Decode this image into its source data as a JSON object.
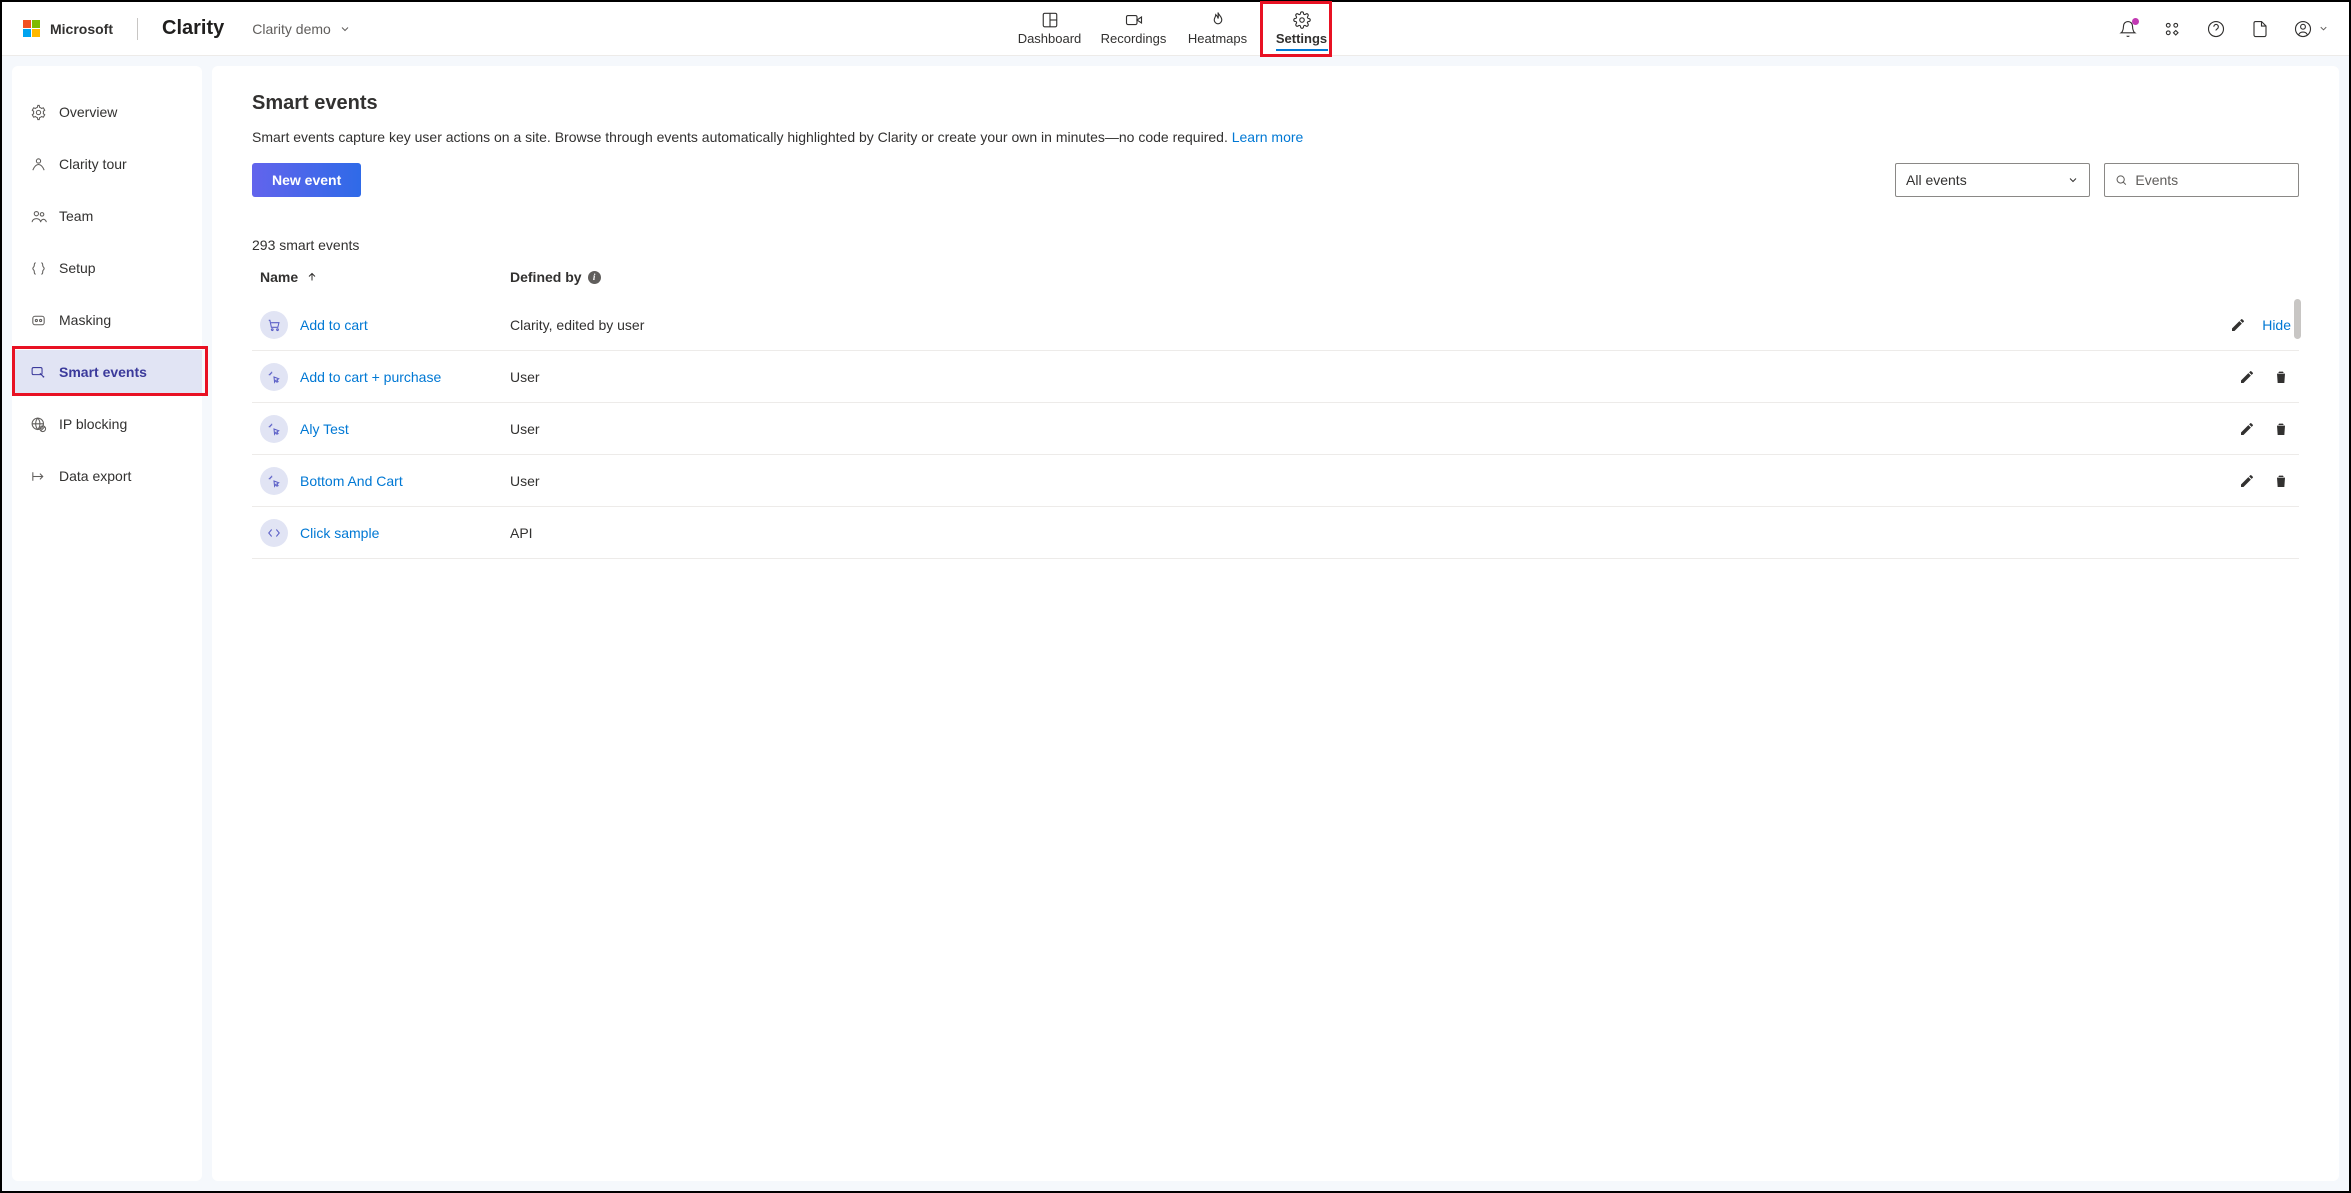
{
  "brand": {
    "company": "Microsoft",
    "product": "Clarity",
    "project": "Clarity demo"
  },
  "topnav": {
    "dashboard": "Dashboard",
    "recordings": "Recordings",
    "heatmaps": "Heatmaps",
    "settings": "Settings"
  },
  "sidebar": {
    "overview": "Overview",
    "tour": "Clarity tour",
    "team": "Team",
    "setup": "Setup",
    "masking": "Masking",
    "smart": "Smart events",
    "ipblock": "IP blocking",
    "export": "Data export"
  },
  "page": {
    "title": "Smart events",
    "desc": "Smart events capture key user actions on a site. Browse through events automatically highlighted by Clarity or create your own in minutes—no code required. ",
    "learn": "Learn more",
    "newBtn": "New event",
    "filterSelected": "All events",
    "searchPlaceholder": "Events",
    "count": "293 smart events"
  },
  "table": {
    "nameHeader": "Name",
    "defHeader": "Defined by",
    "hideLabel": "Hide",
    "rows": [
      {
        "name": "Add to cart",
        "def": "Clarity, edited by user",
        "icon": "cart",
        "actions": "edit-hide"
      },
      {
        "name": "Add to cart + purchase",
        "def": "User",
        "icon": "click",
        "actions": "edit-delete"
      },
      {
        "name": "Aly Test",
        "def": "User",
        "icon": "click",
        "actions": "edit-delete"
      },
      {
        "name": "Bottom And Cart",
        "def": "User",
        "icon": "click",
        "actions": "edit-delete"
      },
      {
        "name": "Click sample",
        "def": "API",
        "icon": "code",
        "actions": "none"
      }
    ]
  }
}
